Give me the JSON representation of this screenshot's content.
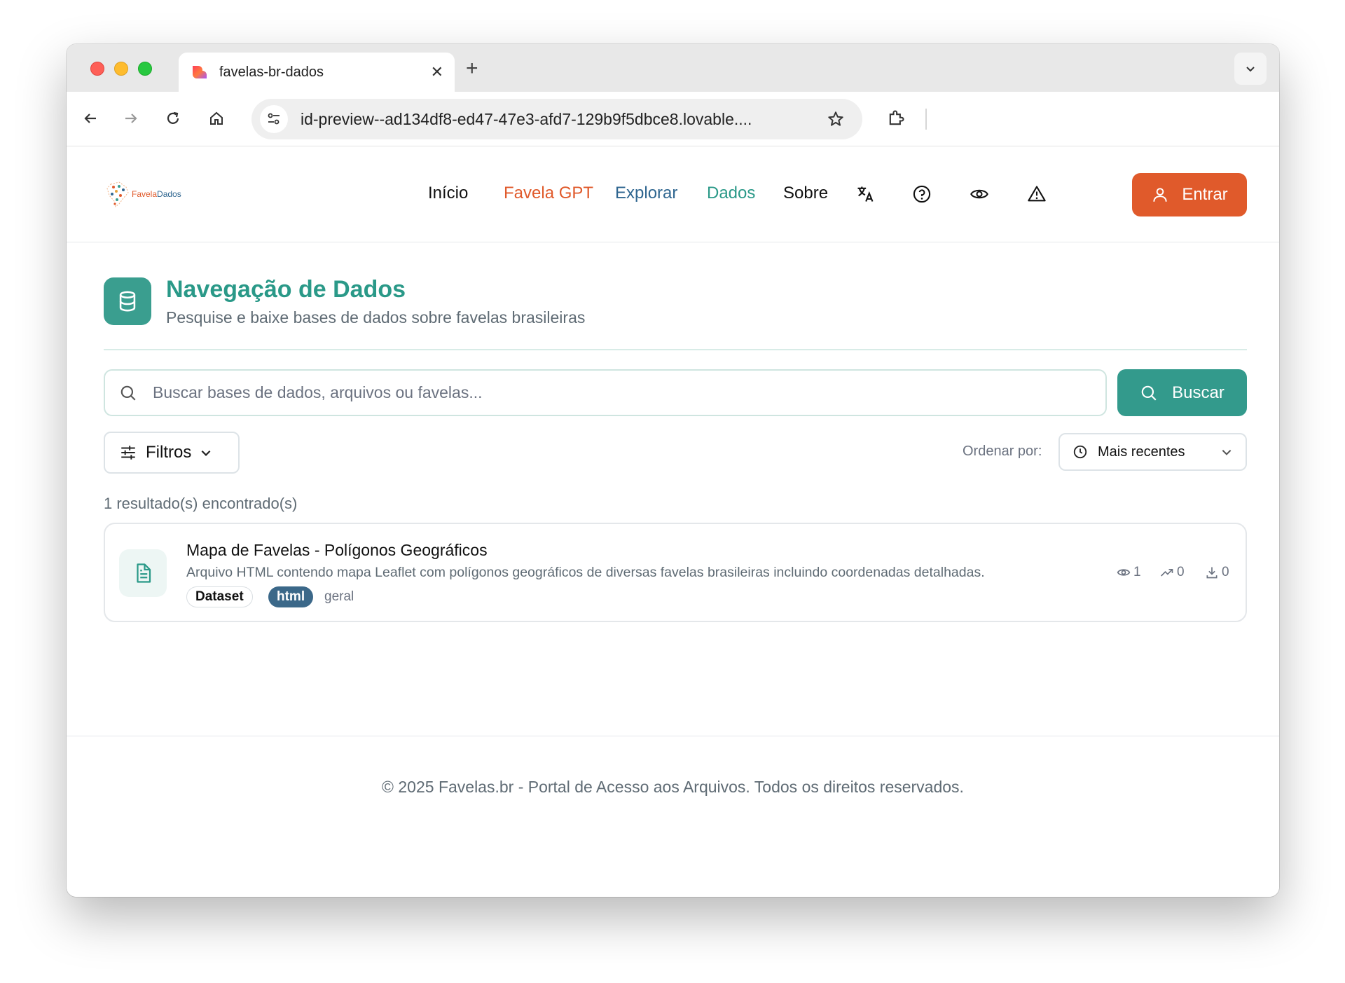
{
  "browser": {
    "tab_title": "favelas-br-dados",
    "new_tab": "+",
    "url": "id-preview--ad134df8-ed47-47e3-afd7-129b9f5dbce8.lovable...."
  },
  "header": {
    "logo_text_a": "Favela",
    "logo_text_b": "Dados",
    "nav": [
      {
        "label": "Início",
        "color": "#111111"
      },
      {
        "label": "Favela GPT",
        "color": "#e05a2b"
      },
      {
        "label": "Explorar",
        "color": "#2f6690"
      },
      {
        "label": "Dados",
        "color": "#2a9988"
      },
      {
        "label": "Sobre",
        "color": "#111111"
      }
    ],
    "icons": [
      "translate-icon",
      "help-icon",
      "eye-icon",
      "alert-icon"
    ],
    "login_label": "Entrar",
    "accent": "#e05a2b"
  },
  "main": {
    "title": "Navegação de Dados",
    "subtitle": "Pesquise e baixe bases de dados sobre favelas brasileiras",
    "search_placeholder": "Buscar bases de dados, arquivos ou favelas...",
    "search_button": "Buscar",
    "filters_label": "Filtros",
    "sort_label": "Ordenar por:",
    "sort_value": "Mais recentes",
    "results_count": "1 resultado(s) encontrado(s)",
    "results": [
      {
        "title": "Mapa de Favelas - Polígonos Geográficos",
        "description": "Arquivo HTML contendo mapa Leaflet com polígonos geográficos de diversas favelas brasileiras incluindo coordenadas detalhadas.",
        "tag_type": "Dataset",
        "tag_format": "html",
        "category": "geral",
        "views": "1",
        "trend": "0",
        "downloads": "0"
      }
    ]
  },
  "footer": {
    "text": "© 2025 Favelas.br - Portal de Acesso aos Arquivos. Todos os direitos reservados."
  }
}
